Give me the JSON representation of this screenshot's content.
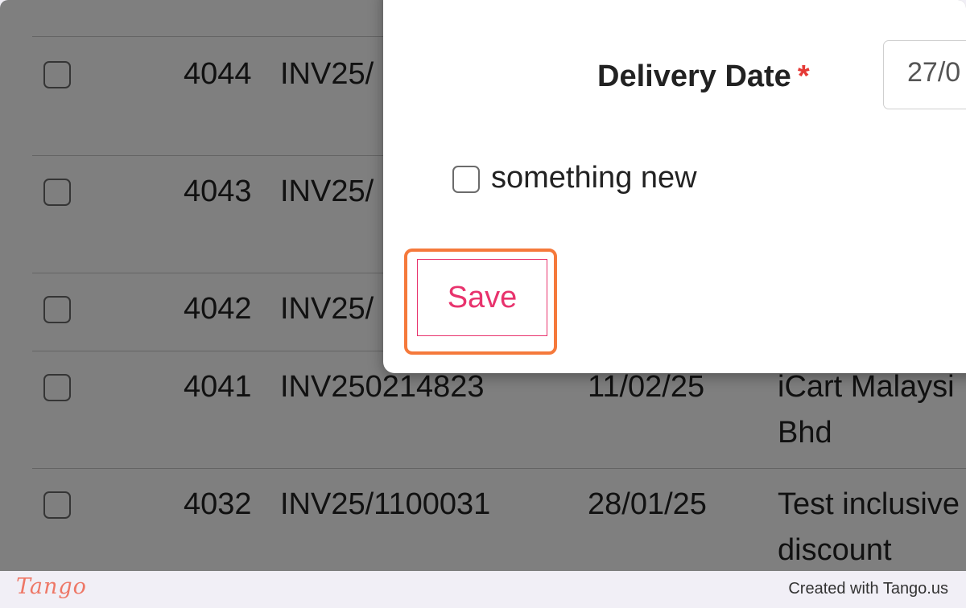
{
  "table": {
    "rows": [
      {
        "id": "4044",
        "invoice": "INV25/",
        "date": "",
        "customer": ""
      },
      {
        "id": "4043",
        "invoice": "INV25/",
        "date": "",
        "customer": ""
      },
      {
        "id": "4042",
        "invoice": "INV25/",
        "date": "",
        "customer": ""
      },
      {
        "id": "4041",
        "invoice": "INV250214823",
        "date": "11/02/25",
        "customer_line1": "iCart Malaysi",
        "customer_line2": "Bhd"
      },
      {
        "id": "4032",
        "invoice": "INV25/1100031",
        "date": "28/01/25",
        "customer_line1": "Test inclusive",
        "customer_line2": "discount"
      }
    ]
  },
  "modal": {
    "delivery_date_label": "Delivery Date",
    "required_mark": "*",
    "delivery_date_value": "27/0",
    "checkbox_label": "something new",
    "save_label": "Save"
  },
  "footer": {
    "brand": "Tango",
    "credit": "Created with Tango.us"
  },
  "colors": {
    "accent": "#e8336d",
    "highlight": "#f5793b",
    "required": "#e53935"
  }
}
